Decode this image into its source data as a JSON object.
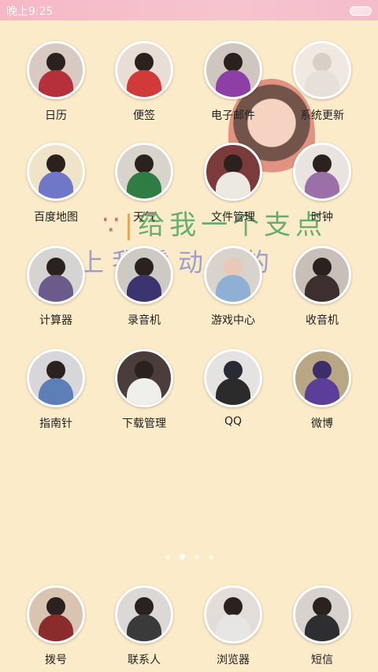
{
  "status_bar": {
    "time": "晚上9:25"
  },
  "wallpaper_banner": {
    "line1": "给我一个支点",
    "line2": "上我撬动你的"
  },
  "apps": [
    {
      "label": "日历",
      "icon": "calendar-icon"
    },
    {
      "label": "便签",
      "icon": "notes-icon"
    },
    {
      "label": "电子邮件",
      "icon": "email-icon"
    },
    {
      "label": "系统更新",
      "icon": "system-update-icon"
    },
    {
      "label": "百度地图",
      "icon": "map-icon"
    },
    {
      "label": "天气",
      "icon": "weather-icon"
    },
    {
      "label": "文件管理",
      "icon": "file-manager-icon"
    },
    {
      "label": "时钟",
      "icon": "clock-icon"
    },
    {
      "label": "计算器",
      "icon": "calculator-icon"
    },
    {
      "label": "录音机",
      "icon": "recorder-icon"
    },
    {
      "label": "游戏中心",
      "icon": "game-center-icon"
    },
    {
      "label": "收音机",
      "icon": "radio-icon"
    },
    {
      "label": "指南针",
      "icon": "compass-icon"
    },
    {
      "label": "下载管理",
      "icon": "download-icon"
    },
    {
      "label": "QQ",
      "icon": "qq-icon"
    },
    {
      "label": "微博",
      "icon": "weibo-icon"
    }
  ],
  "page_indicator": {
    "total": 4,
    "active_index": 1
  },
  "dock": [
    {
      "label": "拨号",
      "icon": "phone-icon"
    },
    {
      "label": "联系人",
      "icon": "contacts-icon"
    },
    {
      "label": "浏览器",
      "icon": "browser-icon"
    },
    {
      "label": "短信",
      "icon": "sms-icon"
    }
  ]
}
